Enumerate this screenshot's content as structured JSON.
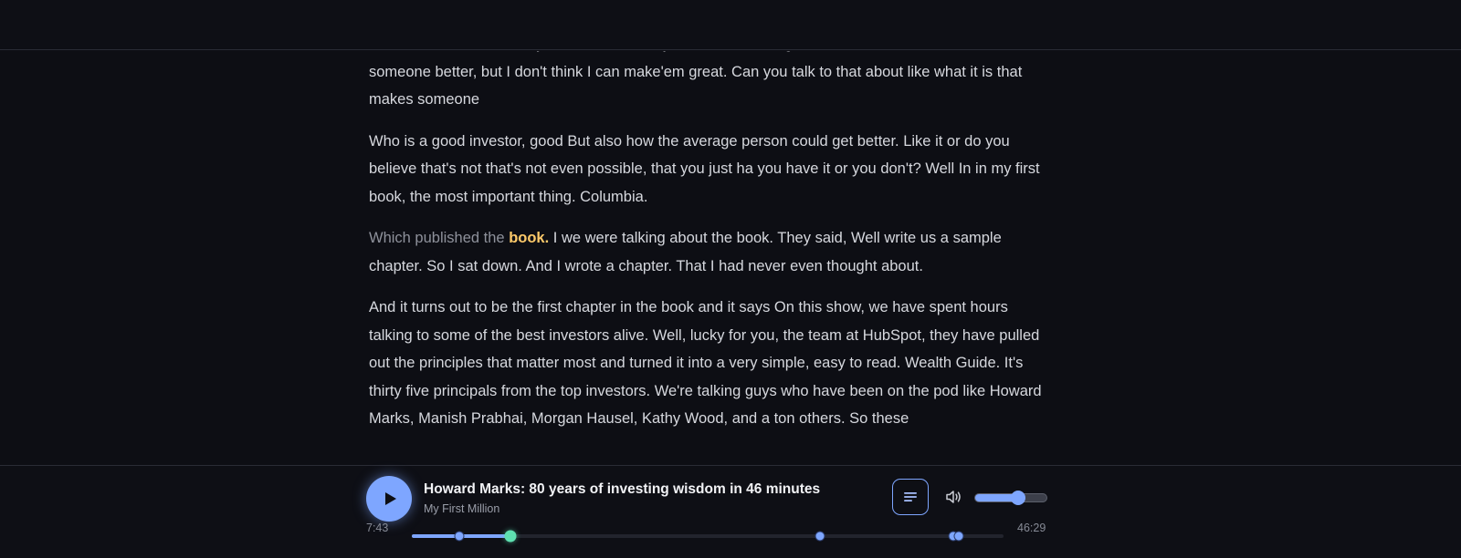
{
  "transcript": {
    "paragraphs": [
      "because I think in one of your books, I think you said something like, I can't make s I can make someone better, but I don't think I can make'em great. Can you talk to that about like what it is that makes someone",
      "Who is a good investor, good But also how the average person could get better. Like it or do you believe that's not that's not even possible, that you just ha you have it or you don't? Well In in my first book, the most important thing. Columbia."
    ],
    "active": {
      "played": "Which published the",
      "current_word": "book.",
      "upcoming": "I we were talking about the book. They said, Well write us a sample chapter. So I sat down. And I wrote a chapter. That I had never even thought about."
    },
    "paragraphs_after": [
      "And it turns out to be the first chapter in the book and it says On this show, we have spent hours talking to some of the best investors alive. Well, lucky for you, the team at HubSpot, they have pulled out the principles that matter most and turned it into a very simple, easy to read. Wealth Guide. It's thirty five principals from the top investors. We're talking guys who have been on the pod like Howard Marks, Manish Prabhai, Morgan Hausel, Kathy Wood, and a ton others. So these"
    ]
  },
  "player": {
    "episode_title": "Howard Marks: 80 years of investing wisdom in 46 minutes",
    "show_name": "My First Million",
    "current_time": "7:43",
    "total_time": "46:29",
    "progress_fraction": 0.166,
    "chapter_markers": [
      0.08,
      0.69,
      0.915,
      0.925
    ],
    "volume_fraction": 0.6,
    "icons": {
      "play": "play-icon",
      "transcript": "transcript-lines-icon",
      "volume": "volume-icon"
    },
    "colors": {
      "accent": "#7ea6ff",
      "playhead": "#5ee0b0",
      "highlight": "#fcc96a"
    }
  }
}
